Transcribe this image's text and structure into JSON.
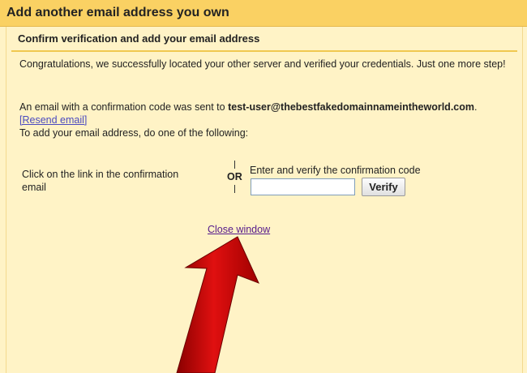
{
  "window": {
    "title": "Add another email address you own"
  },
  "section": {
    "heading": "Confirm verification and add your email address"
  },
  "message": {
    "congrats": "Congratulations, we successfully located your other server and verified your credentials. Just one more step!",
    "sent_prefix": "An email with a confirmation code was sent to ",
    "email": "test-user@thebestfakedomainnameintheworld.com",
    "sent_suffix": ".",
    "resend_link": "[Resend email]",
    "instructions": "To add your email address, do one of the following:"
  },
  "options": {
    "click_link_text": "Click on the link in the confirmation email",
    "or_label": "OR",
    "enter_code_label": "Enter and verify the confirmation code",
    "code_value": "",
    "verify_button": "Verify"
  },
  "footer": {
    "close_link": "Close window"
  },
  "colors": {
    "title_bar": "#fad163",
    "background": "#fff3c6",
    "link": "#551a8b",
    "annotation_arrow": "#d40000"
  },
  "icons": {
    "annotation": "red-arrow-annotation"
  }
}
